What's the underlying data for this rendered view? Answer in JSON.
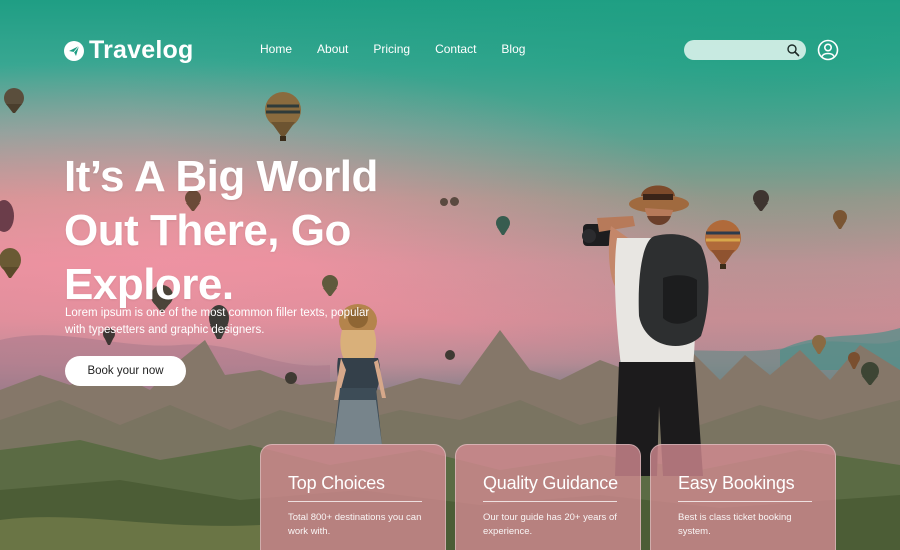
{
  "brand": {
    "name": "Travelog",
    "logo_icon": "paper-plane-icon"
  },
  "nav": {
    "links": [
      "Home",
      "About",
      "Pricing",
      "Contact",
      "Blog"
    ],
    "search_icon": "search-icon",
    "user_icon": "user-icon"
  },
  "hero": {
    "headline": "It’s A Big World Out There, Go Explore.",
    "subtitle": "Lorem ipsum is one of the most common filler texts, popular with typesetters and graphic designers.",
    "cta_label": "Book your now"
  },
  "cards": [
    {
      "title": "Top Choices",
      "text": "Total 800+ destinations you can work with."
    },
    {
      "title": "Quality Guidance",
      "text": "Our tour guide has 20+ years of experience."
    },
    {
      "title": "Easy Bookings",
      "text": "Best is class ticket booking system."
    }
  ],
  "colors": {
    "sky_top": "#1f9e84",
    "sky_pink": "#e28f99",
    "card_bg": "#d68c94",
    "button_bg": "#ffffff"
  }
}
